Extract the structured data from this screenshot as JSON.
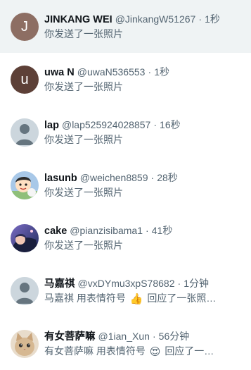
{
  "conversations": [
    {
      "name": "JINKANG WEI",
      "handle": "@JinkangW51267",
      "time": "1秒",
      "preview": "你发送了一张照片",
      "avatar_letter": "J",
      "avatar_color": "#8d6e63",
      "selected": true
    },
    {
      "name": "uwa N",
      "handle": "@uwaN536553",
      "time": "1秒",
      "preview": "你发送了一张照片",
      "avatar_letter": "u",
      "avatar_color": "#5d4037"
    },
    {
      "name": "lap",
      "handle": "@lap525924028857",
      "time": "16秒",
      "preview": "你发送了一张照片",
      "avatar": "default-avatar-icon"
    },
    {
      "name": "lasunb",
      "handle": "@weichen8859",
      "time": "28秒",
      "preview": "你发送了一张照片",
      "avatar": "cartoon-avatar-icon"
    },
    {
      "name": "cake",
      "handle": "@pianzisibama1",
      "time": "41秒",
      "preview": "你发送了一张照片",
      "avatar": "anime-avatar-icon"
    },
    {
      "name": "马嘉祺",
      "handle": "@vxDYmu3xpS78682",
      "time": "1分钟",
      "preview_prefix": "马嘉祺 用表情符号",
      "preview_emoji": "👍",
      "preview_suffix": "回应了一张照…",
      "avatar": "default-avatar-icon"
    },
    {
      "name": "有女菩萨嘛",
      "handle": "@1ian_Xun",
      "time": "56分钟",
      "preview_prefix": "有女菩萨嘛 用表情符号",
      "preview_emoji": "😍",
      "preview_suffix": "回应了一…",
      "avatar": "cat-avatar-icon"
    }
  ],
  "separator": "·"
}
